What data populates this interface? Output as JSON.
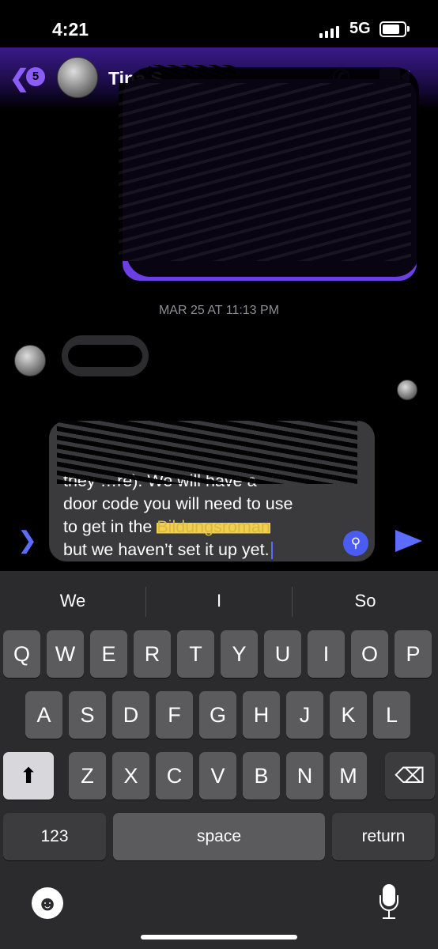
{
  "status_bar": {
    "time": "4:21",
    "network": "5G",
    "battery_level": 0.8
  },
  "header": {
    "back_count": "5",
    "contact_name": "Tina S…",
    "back_glyph": "❮"
  },
  "timestamp": "MAR 25 AT 11:13 PM",
  "composer": {
    "lines": [
      "they …re). We will have a",
      "door code you will need to use",
      "to get in the "
    ],
    "highlight_word": "Bildungsroman",
    "last_line": "but we haven’t set it up yet."
  },
  "keyboard": {
    "suggestions": [
      "We",
      "I",
      "So"
    ],
    "row1": [
      "Q",
      "W",
      "E",
      "R",
      "T",
      "Y",
      "U",
      "I",
      "O",
      "P"
    ],
    "row2": [
      "A",
      "S",
      "D",
      "F",
      "G",
      "H",
      "J",
      "K",
      "L"
    ],
    "row3": [
      "Z",
      "X",
      "C",
      "V",
      "B",
      "N",
      "M"
    ],
    "numbers_key": "123",
    "space_key": "space",
    "return_key": "return"
  },
  "icons": [
    "back-icon",
    "phone-icon",
    "video-icon",
    "chevron-right-icon",
    "lookup-icon",
    "send-icon",
    "shift-icon",
    "delete-icon",
    "emoji-icon",
    "microphone-icon"
  ],
  "colors": {
    "accent": "#8b5cf6",
    "send": "#5b6cff",
    "highlight": "#f2d04b"
  }
}
